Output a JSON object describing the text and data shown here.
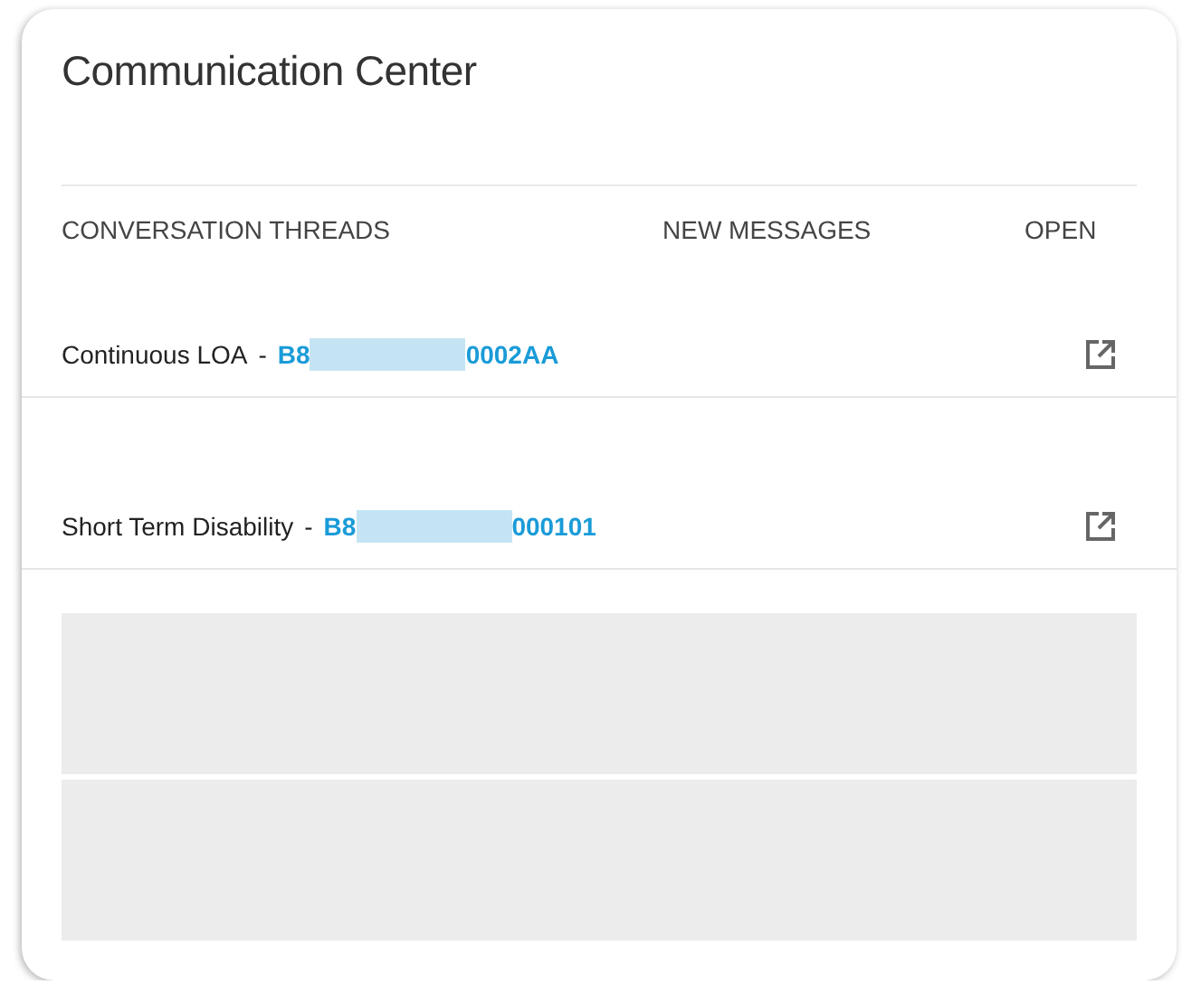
{
  "title": "Communication Center",
  "columns": [
    "CONVERSATION THREADS",
    "NEW MESSAGES",
    "OPEN"
  ],
  "threads": [
    {
      "type": "Continuous LOA",
      "separator": "-",
      "id_start": "B8",
      "id_end": "0002AA"
    },
    {
      "type": "Short Term Disability",
      "separator": "-",
      "id_start": "B8",
      "id_end": "000101"
    }
  ],
  "placeholders": [
    {
      "kind": "block"
    },
    {
      "kind": "block"
    }
  ]
}
